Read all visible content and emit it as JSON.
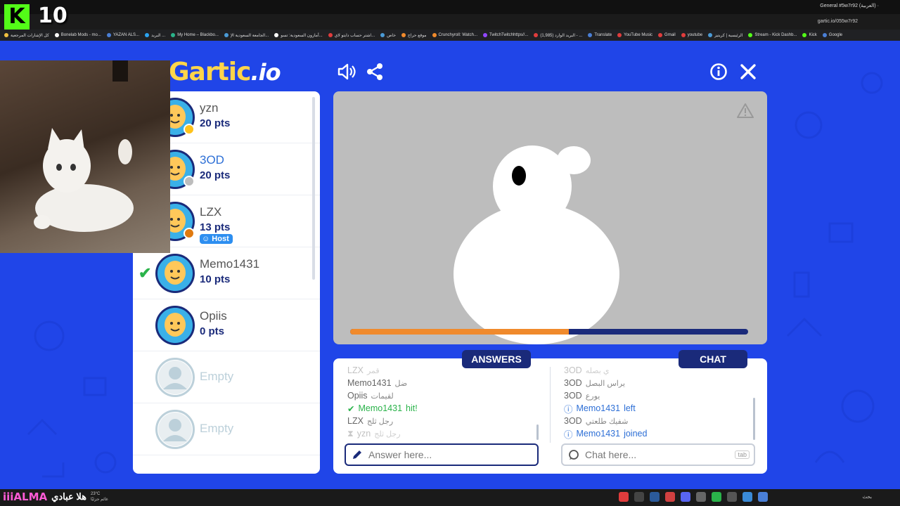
{
  "browser": {
    "tab_title": "General #5w7r92 (العربية) ·",
    "url": "gartic.io/055w7r92",
    "bookmarks": [
      {
        "label": "كل الإشارات المرجعية",
        "color": "#f0c040"
      },
      {
        "label": "Bonelab Mods - mo...",
        "color": "#ffffff"
      },
      {
        "label": "YAZAN ALS...",
        "color": "#4a7fd6"
      },
      {
        "label": "البريد ...",
        "color": "#2ba3f0"
      },
      {
        "label": "My Home – Blackbo...",
        "color": "#2ab38a"
      },
      {
        "label": "الجامعة السعودية الإ...",
        "color": "#4a9ad6"
      },
      {
        "label": "أمازون السعودية: تسو...",
        "color": "#ffffff"
      },
      {
        "label": "اشتر حساب دايتو لاي...",
        "color": "#e03c3c"
      },
      {
        "label": "خاص",
        "color": "#4a9ad6"
      },
      {
        "label": "موقع حراج",
        "color": "#f08a2c"
      },
      {
        "label": "Crunchyroll: Watch...",
        "color": "#f08a2c"
      },
      {
        "label": "TwitchTwitchhttps//...",
        "color": "#9147ff"
      },
      {
        "label": "(1,985) البريد الوارد - ...",
        "color": "#e03c3c"
      },
      {
        "label": "Translate",
        "color": "#4a7fd6"
      },
      {
        "label": "YouTube Music",
        "color": "#e03c3c"
      },
      {
        "label": "Gmail",
        "color": "#e03c3c"
      },
      {
        "label": "youtube",
        "color": "#e03c3c"
      },
      {
        "label": "الرئيسية | كريتيز",
        "color": "#4a9ad6"
      },
      {
        "label": "Stream - Kick Dashb...",
        "color": "#53fc18"
      },
      {
        "label": "Kick",
        "color": "#53fc18"
      },
      {
        "label": "Google",
        "color": "#4a7fd6"
      }
    ]
  },
  "overlay": {
    "kick_letter": "K",
    "counter": "10"
  },
  "game": {
    "logo_main": "Gartic",
    "logo_accent": ".io",
    "players": [
      {
        "name": "yzn",
        "points": "20 pts",
        "dot_color": "#ffc21a",
        "name_style": "normal"
      },
      {
        "name": "3OD",
        "points": "20 pts",
        "dot_color": "#bdbdbd",
        "name_style": "blue"
      },
      {
        "name": "LZX",
        "points": "13 pts",
        "dot_color": "#e07a10",
        "name_style": "normal",
        "host": "Host"
      },
      {
        "name": "Memo1431",
        "points": "10 pts",
        "name_style": "normal",
        "guessed": true
      },
      {
        "name": "Opiis",
        "points": "0 pts",
        "name_style": "normal"
      },
      {
        "name": "Empty",
        "empty": true
      },
      {
        "name": "Empty",
        "empty": true
      }
    ],
    "answers_label": "ANSWERS",
    "chat_label": "CHAT",
    "answers": [
      {
        "who": "LZX",
        "text": "قمر",
        "style": "faded"
      },
      {
        "who": "Memo1431",
        "text": "ضل",
        "style": "normal"
      },
      {
        "who": "Opiis",
        "text": "لقيمات",
        "style": "normal"
      },
      {
        "who": "Memo1431",
        "text": "hit!",
        "style": "hit"
      },
      {
        "who": "LZX",
        "text": "رجل ثلج",
        "style": "normal"
      },
      {
        "who": "yzn",
        "text": "رجل ثلج",
        "style": "faded"
      }
    ],
    "chat": [
      {
        "who": "3OD",
        "text": "ي بصله",
        "style": "faded"
      },
      {
        "who": "3OD",
        "text": "يراس البصل",
        "style": "normal"
      },
      {
        "who": "3OD",
        "text": "يورع",
        "style": "normal"
      },
      {
        "who": "Memo1431",
        "text": "left",
        "style": "info"
      },
      {
        "who": "3OD",
        "text": "شفيك طلعتي",
        "style": "normal"
      },
      {
        "who": "Memo1431",
        "text": "joined",
        "style": "info"
      }
    ],
    "answer_placeholder": "Answer here...",
    "chat_placeholder": "Chat here...",
    "tab_hint": "tab",
    "timer_fraction": 0.55
  },
  "taskbar": {
    "brand": "iiiALMA",
    "arabic_name": "هلا عبادي",
    "weather_temp": "23°C",
    "weather_desc": "غائم جزئيًا",
    "search": "بحث"
  },
  "colors": {
    "background": "#2045e8",
    "navy": "#1a2a7a",
    "orange": "#f08a2c",
    "green": "#2ab34a",
    "blue": "#2d6fd6"
  }
}
